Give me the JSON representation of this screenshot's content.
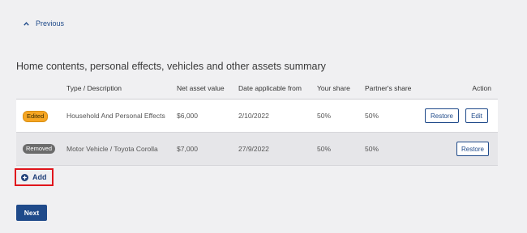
{
  "nav": {
    "previous_label": "Previous"
  },
  "section": {
    "title": "Home contents, personal effects, vehicles and other assets summary"
  },
  "table": {
    "headers": {
      "type": "Type / Description",
      "net": "Net asset value",
      "date": "Date applicable from",
      "your": "Your share",
      "partner": "Partner's share",
      "action": "Action"
    },
    "rows": [
      {
        "badge": "Edited",
        "type": "Household And Personal Effects",
        "net": "$6,000",
        "date": "2/10/2022",
        "your": "50%",
        "partner": "50%",
        "restore_label": "Restore",
        "edit_label": "Edit"
      },
      {
        "badge": "Removed",
        "type": "Motor Vehicle / Toyota Corolla",
        "net": "$7,000",
        "date": "27/9/2022",
        "your": "50%",
        "partner": "50%",
        "restore_label": "Restore"
      }
    ]
  },
  "actions": {
    "add_label": "Add",
    "next_label": "Next"
  },
  "colors": {
    "primary": "#1f4a8a",
    "edited_badge": "#f6a623",
    "removed_badge": "#6b6b6b",
    "highlight": "#e0151c"
  }
}
